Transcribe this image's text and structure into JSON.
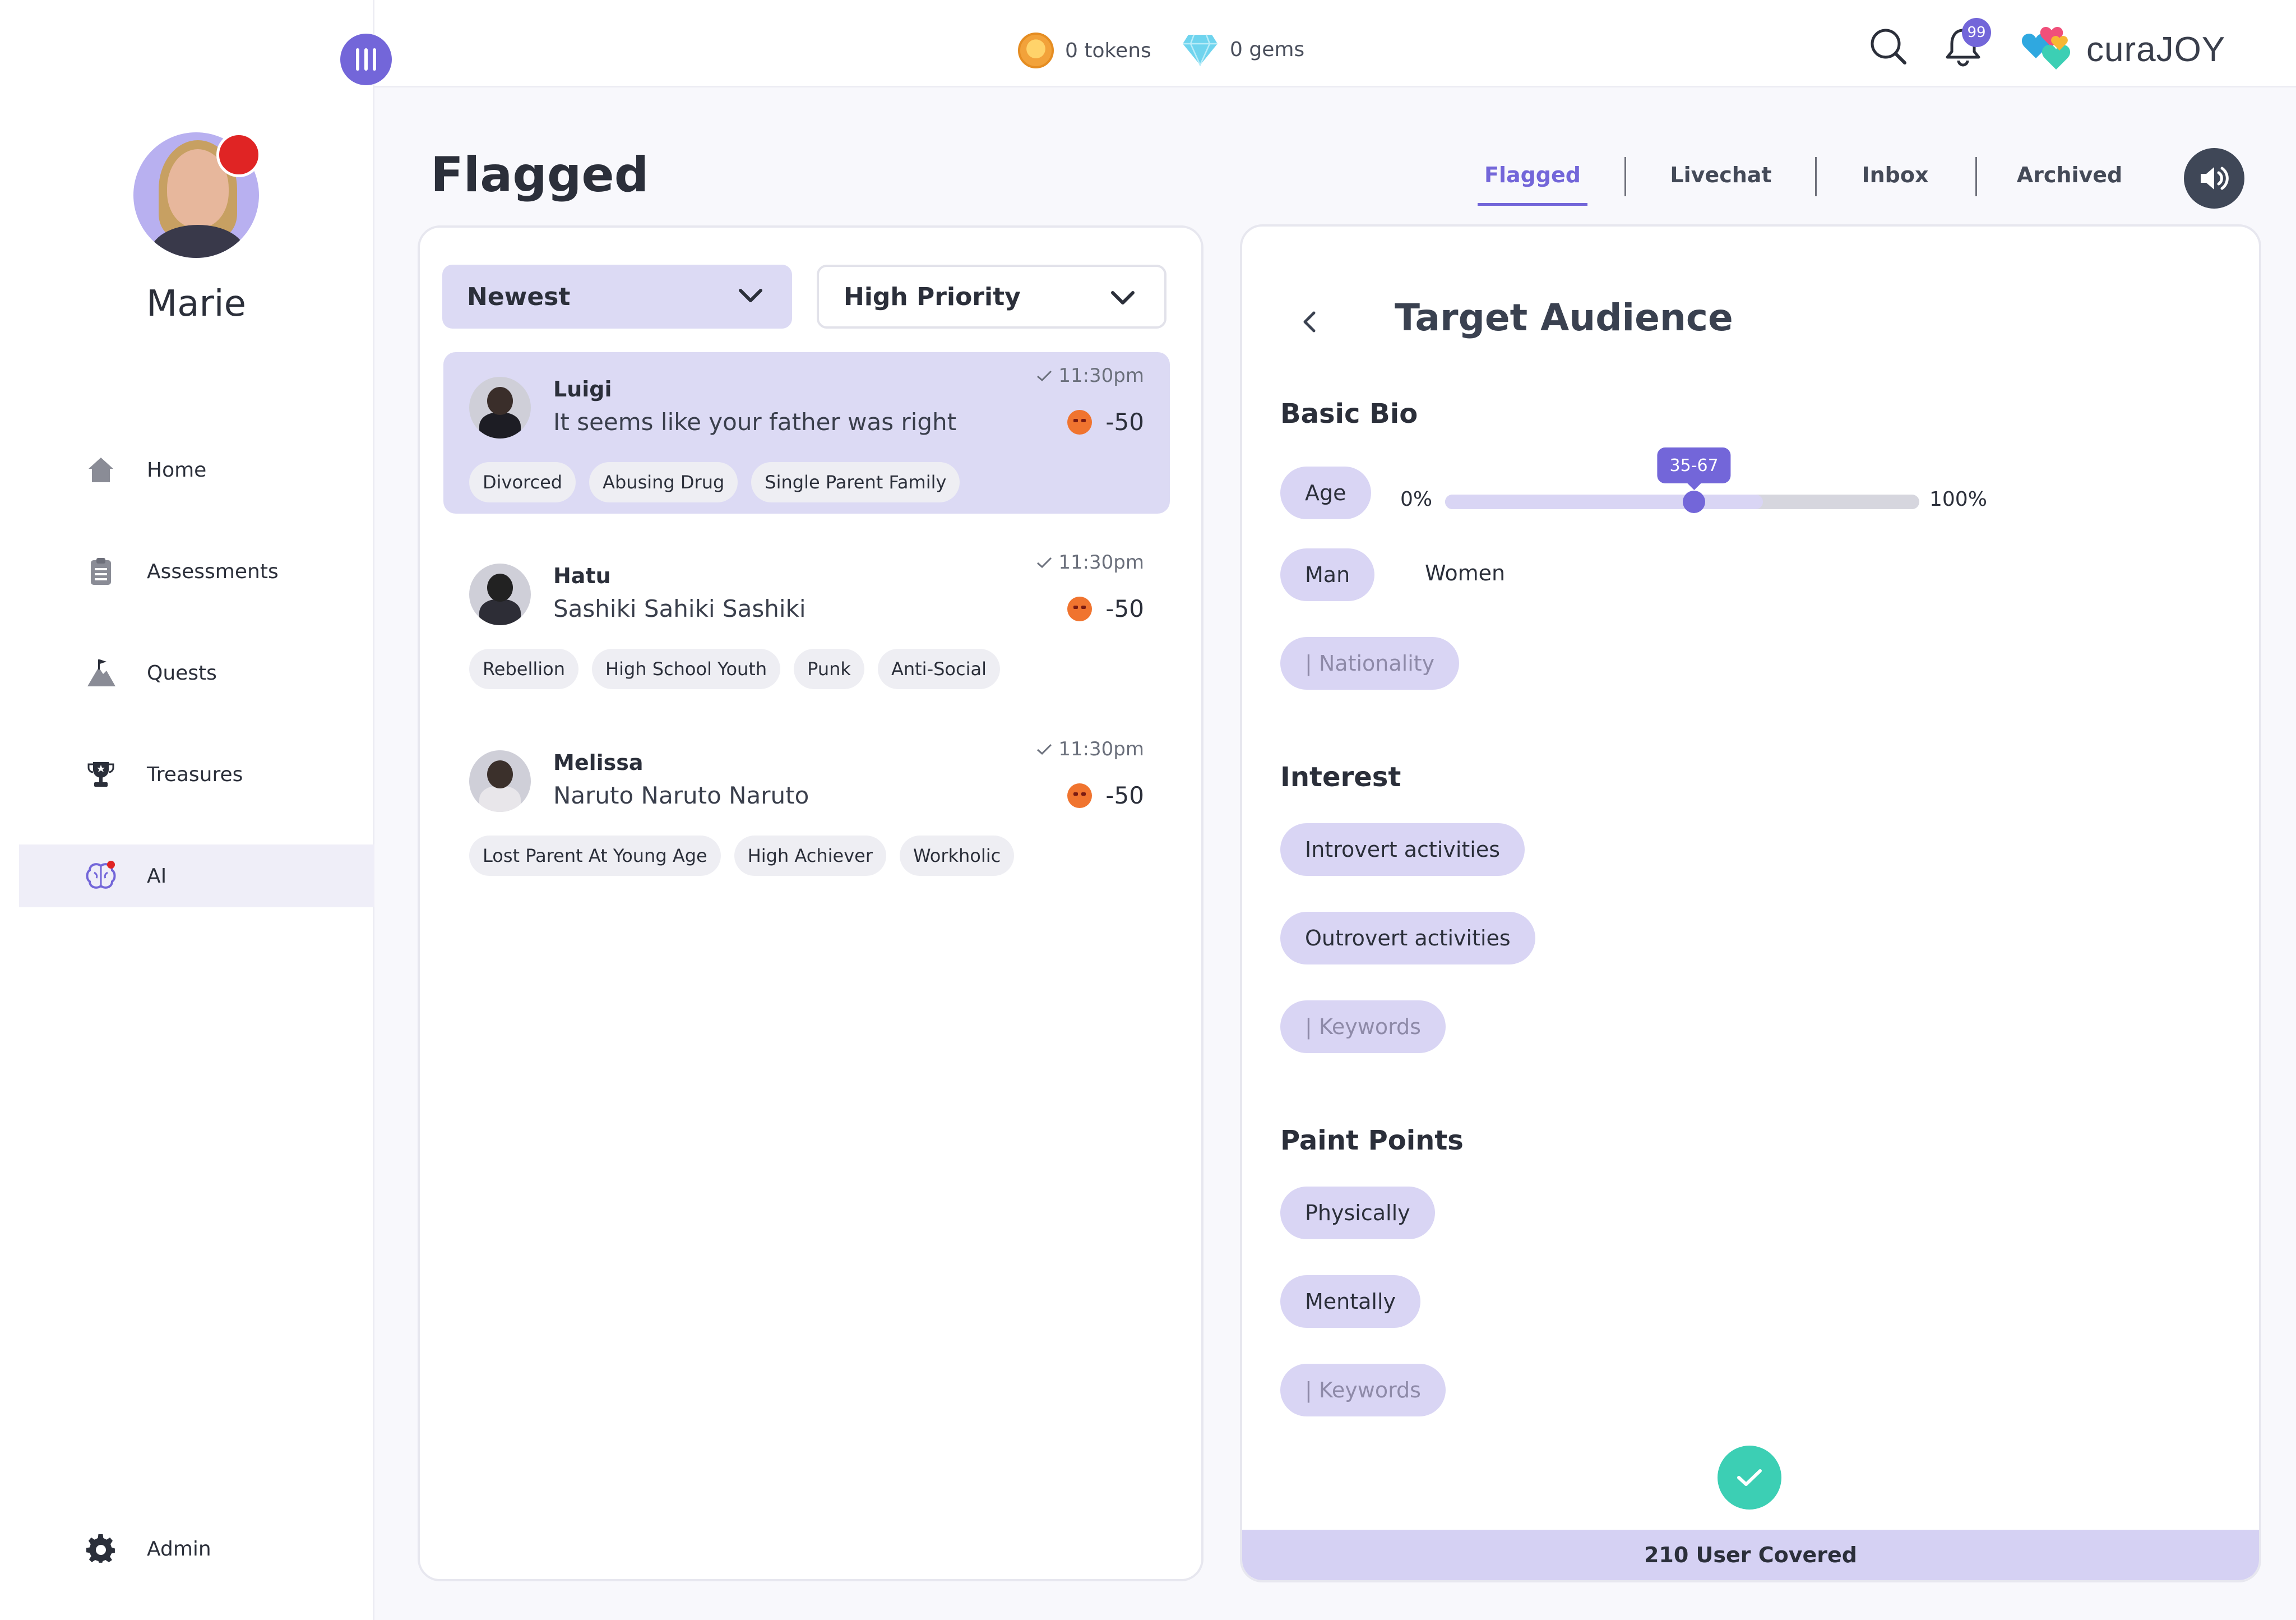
{
  "sidebar": {
    "user_name": "Marie",
    "items": [
      {
        "label": "Home",
        "icon": "home-icon"
      },
      {
        "label": "Assessments",
        "icon": "clipboard-icon"
      },
      {
        "label": "Quests",
        "icon": "mountain-flag-icon"
      },
      {
        "label": "Treasures",
        "icon": "trophy-icon"
      },
      {
        "label": "AI",
        "icon": "brain-icon",
        "active": true
      },
      {
        "label": "Admin",
        "icon": "gear-icon"
      }
    ]
  },
  "topbar": {
    "tokens_label": "0 tokens",
    "gems_label": "0 gems",
    "notification_count": "99",
    "logo_text": "curaJOY"
  },
  "page": {
    "title": "Flagged",
    "tabs": [
      "Flagged",
      "Livechat",
      "Inbox",
      "Archived"
    ],
    "active_tab": "Flagged"
  },
  "list": {
    "sort_label": "Newest",
    "filter_label": "High Priority",
    "messages": [
      {
        "name": "Luigi",
        "text": "It seems like your father was right",
        "time": "11:30pm",
        "score": "-50",
        "tags": [
          "Divorced",
          "Abusing Drug",
          "Single Parent Family"
        ],
        "selected": true
      },
      {
        "name": "Hatu",
        "text": "Sashiki Sahiki Sashiki",
        "time": "11:30pm",
        "score": "-50",
        "tags": [
          "Rebellion",
          "High School Youth",
          "Punk",
          "Anti-Social"
        ]
      },
      {
        "name": "Melissa",
        "text": "Naruto Naruto Naruto",
        "time": "11:30pm",
        "score": "-50",
        "tags": [
          "Lost Parent At Young Age",
          "High Achiever",
          "Workholic"
        ]
      }
    ]
  },
  "audience": {
    "title": "Target Audience",
    "basic_bio": {
      "heading": "Basic Bio",
      "age_label": "Age",
      "range_min_label": "0%",
      "range_max_label": "100%",
      "range_value": "35-67",
      "range_start_pct": 35,
      "range_end_pct": 67,
      "gender_selected": "Man",
      "gender_other": "Women",
      "nationality_placeholder": "| Nationality"
    },
    "interest": {
      "heading": "Interest",
      "options": [
        "Introvert activities",
        "Outrovert activities"
      ],
      "keywords_placeholder": "| Keywords"
    },
    "pain_points": {
      "heading": "Paint Points",
      "options": [
        "Physically",
        "Mentally"
      ],
      "keywords_placeholder": "| Keywords"
    },
    "coverage_label": "210 User Covered"
  },
  "colors": {
    "accent": "#7366d9",
    "pill": "#d9d5f4",
    "confirm": "#3ccfb4",
    "badge": "#e02424"
  }
}
